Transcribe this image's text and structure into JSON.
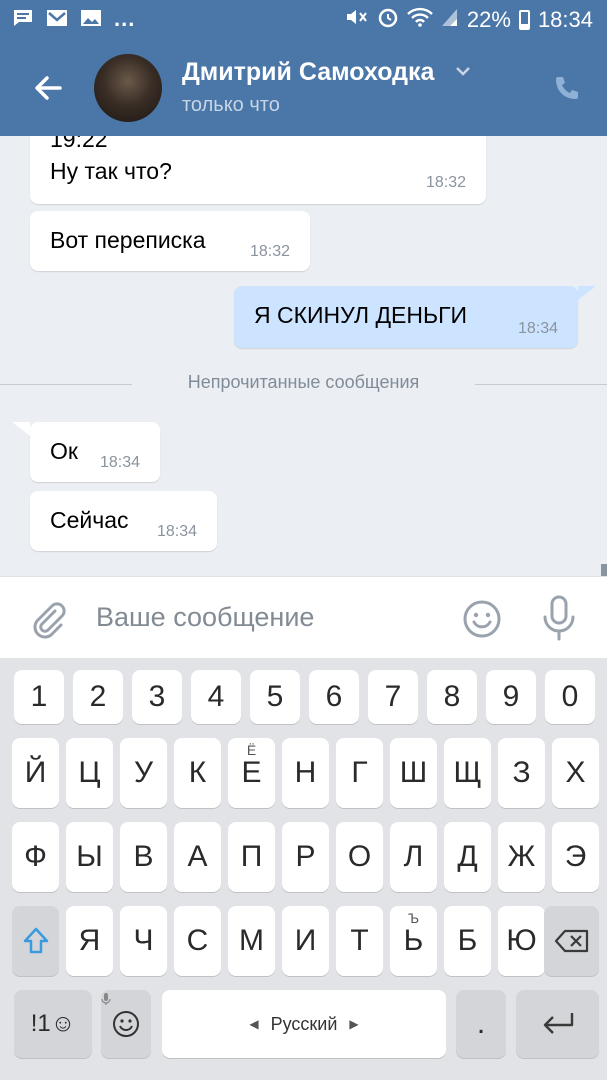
{
  "status_bar": {
    "dots": "...",
    "battery_percent": "22%",
    "time": "18:34"
  },
  "header": {
    "contact_name": "Дмитрий Самоходка",
    "contact_status": "только что"
  },
  "messages": [
    {
      "direction": "in",
      "partial_top": "19:22",
      "text": "Ну так что?",
      "time": "18:32"
    },
    {
      "direction": "in",
      "text": "Вот переписка",
      "time": "18:32"
    },
    {
      "direction": "out",
      "text": "Я СКИНУЛ ДЕНЬГИ",
      "time": "18:34"
    },
    {
      "direction": "in",
      "text": "Ок",
      "time": "18:34"
    },
    {
      "direction": "in",
      "text": "Сейчас",
      "time": "18:34"
    }
  ],
  "unread_divider": "Непрочитанные сообщения",
  "composer": {
    "placeholder": "Ваше сообщение"
  },
  "keyboard": {
    "row_digits": [
      "1",
      "2",
      "3",
      "4",
      "5",
      "6",
      "7",
      "8",
      "9",
      "0"
    ],
    "row1": [
      "Й",
      "Ц",
      "У",
      "К",
      "Е",
      "Н",
      "Г",
      "Ш",
      "Щ",
      "З",
      "Х"
    ],
    "row1_hint_e": "Ё",
    "row2": [
      "Ф",
      "Ы",
      "В",
      "А",
      "П",
      "Р",
      "О",
      "Л",
      "Д",
      "Ж",
      "Э"
    ],
    "row3": [
      "Я",
      "Ч",
      "С",
      "М",
      "И",
      "Т",
      "Ь",
      "Б",
      "Ю"
    ],
    "row3_hint_soft": "Ъ",
    "symbols_key": "!1☺",
    "space_label": "Русский",
    "period": "."
  }
}
